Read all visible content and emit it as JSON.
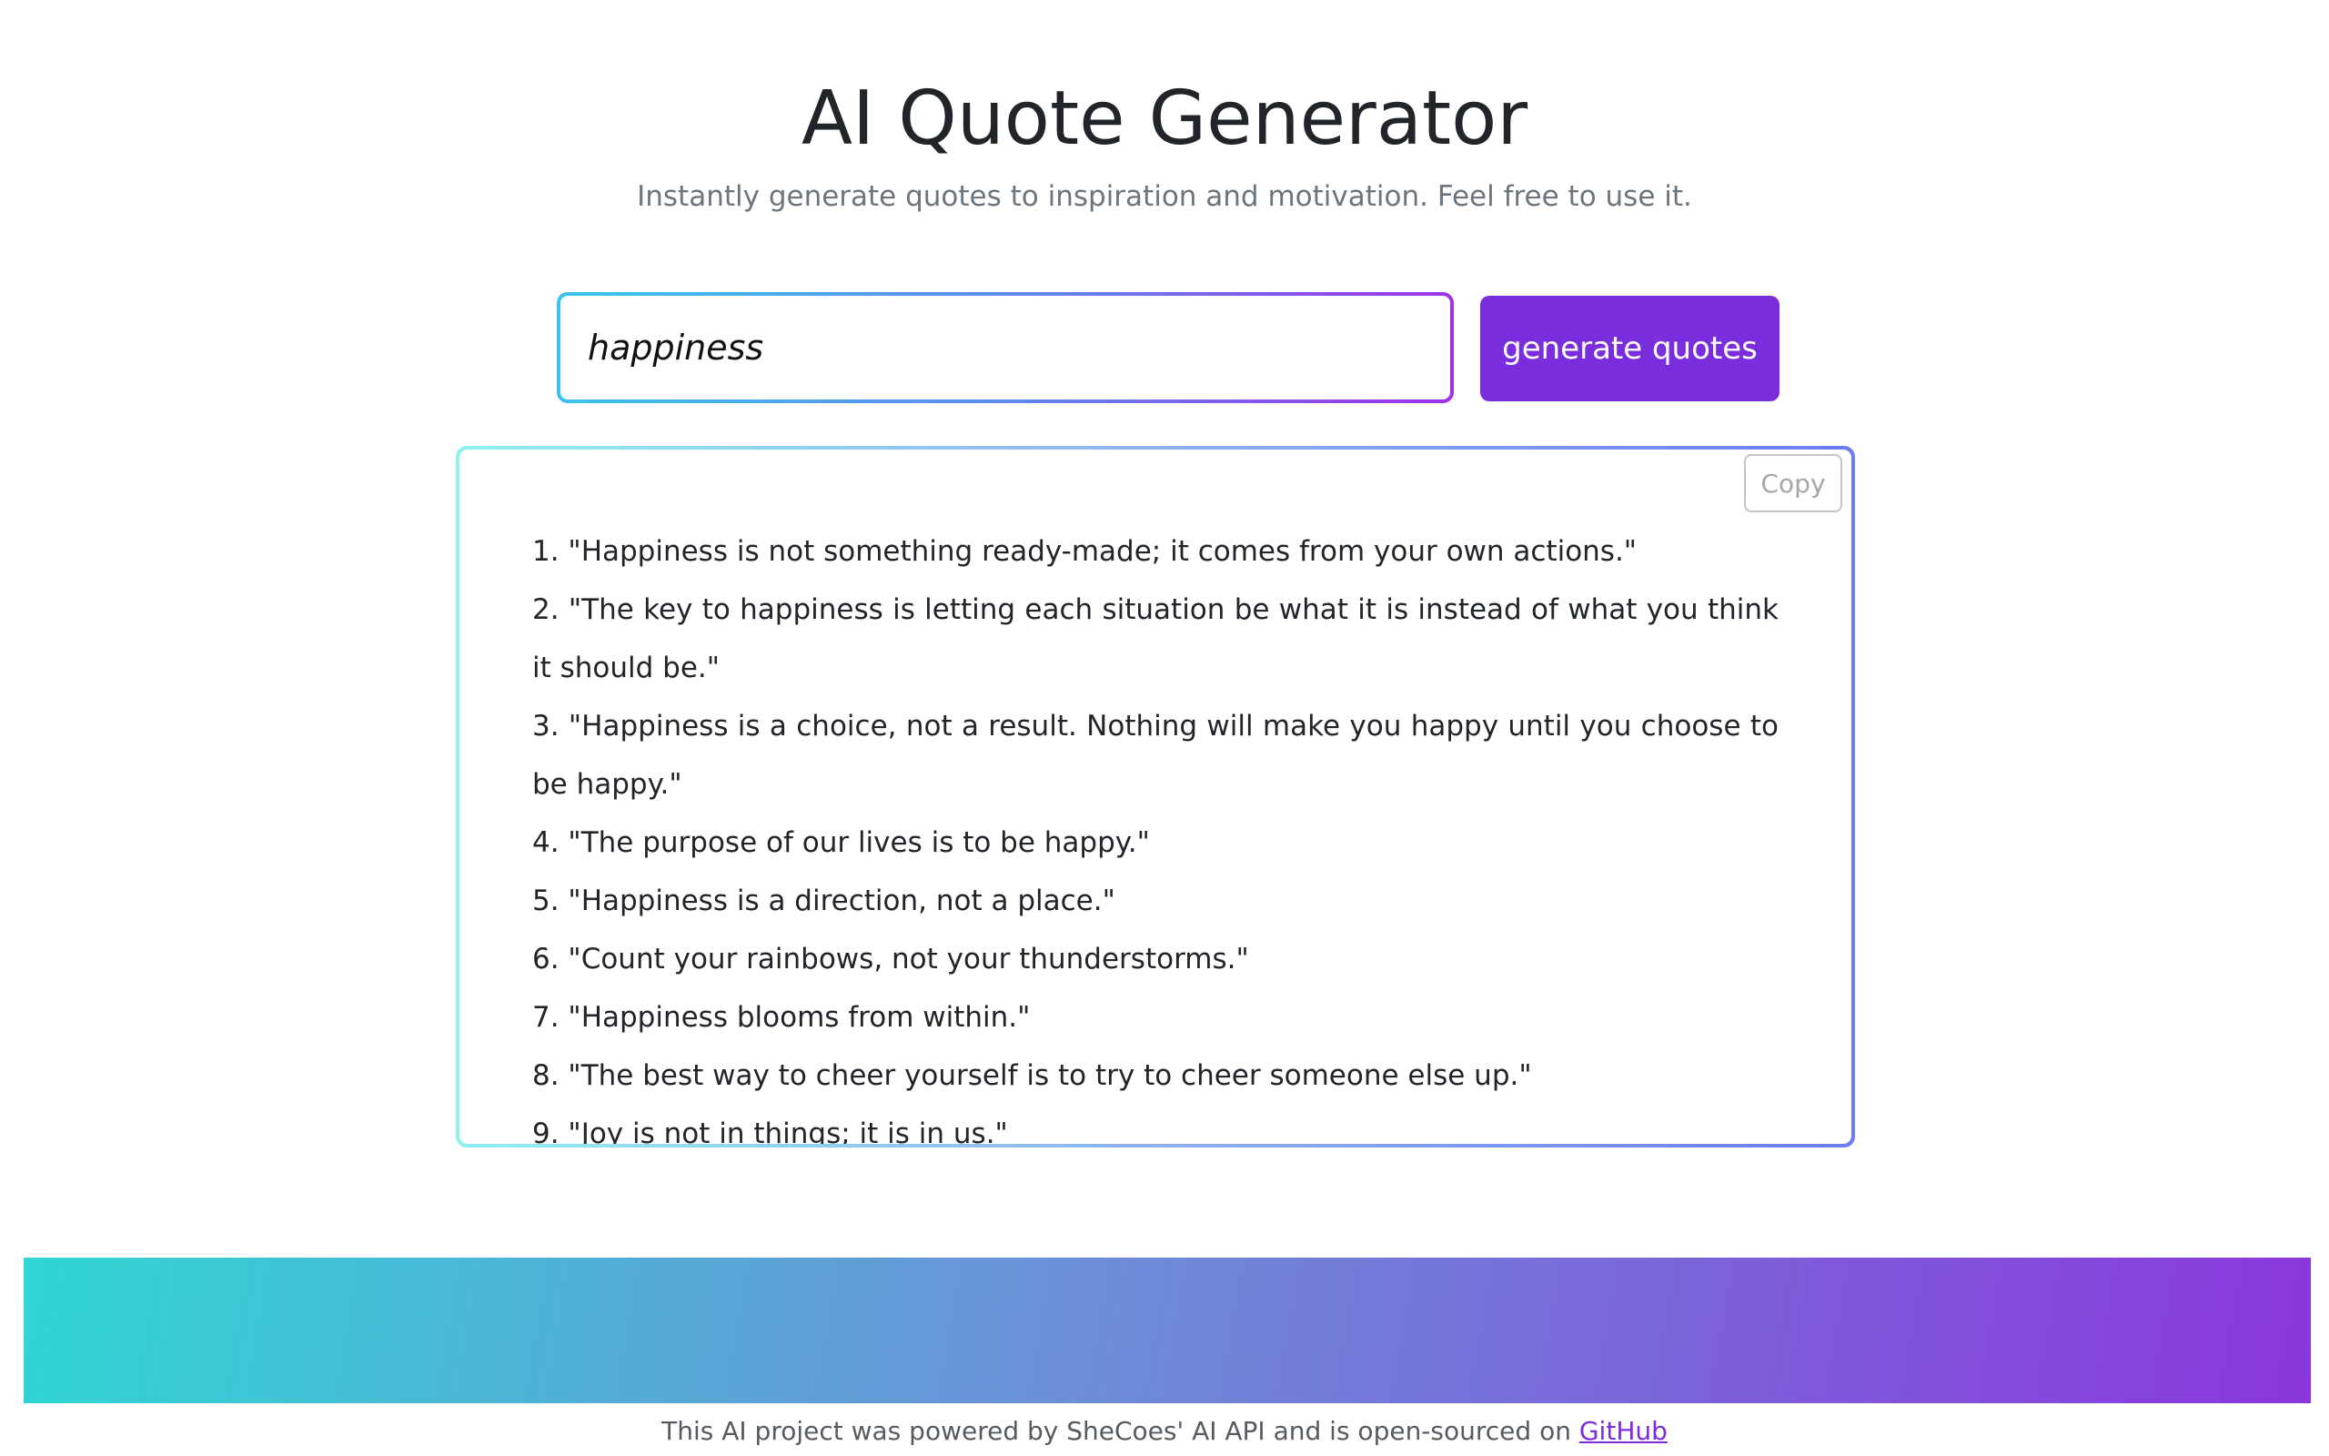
{
  "header": {
    "title": "AI Quote Generator",
    "subtitle": "Instantly generate quotes to inspiration and motivation. Feel free to use it."
  },
  "search": {
    "value": "happiness",
    "button_label": "generate quotes"
  },
  "results": {
    "copy_label": "Copy",
    "quotes": [
      "1. \"Happiness is not something ready-made; it comes from your own actions.\"",
      "2. \"The key to happiness is letting each situation be what it is instead of what you think it should be.\"",
      "3. \"Happiness is a choice, not a result. Nothing will make you happy until you choose to be happy.\"",
      "4. \"The purpose of our lives is to be happy.\"",
      "5. \"Happiness is a direction, not a place.\"",
      "6. \"Count your rainbows, not your thunderstorms.\"",
      "7. \"Happiness blooms from within.\"",
      "8. \"The best way to cheer yourself is to try to cheer someone else up.\"",
      "9. \"Joy is not in things; it is in us.\""
    ]
  },
  "footer": {
    "text_before": "This AI project was powered by SheCoes' AI API and is open-sourced on ",
    "link_label": "GitHub"
  },
  "colors": {
    "accent": "#7a2ddc",
    "gradient_start": "#2fd6d4",
    "gradient_end": "#8a36dc"
  }
}
